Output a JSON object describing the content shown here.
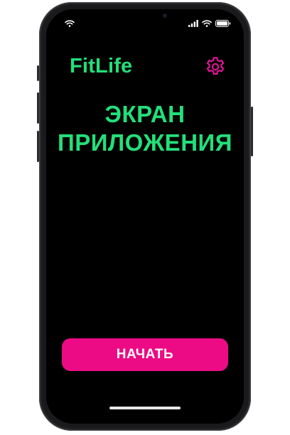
{
  "app": {
    "title": "FitLife",
    "heading_line1": "ЭКРАН",
    "heading_line2": "ПРИЛОЖЕНИЯ"
  },
  "actions": {
    "start_label": "НАЧАТЬ"
  },
  "icons": {
    "settings": "gear-icon",
    "wifi_left": "wifi-icon",
    "cellular": "cellular-signal-icon",
    "wifi_right": "wifi-icon",
    "battery": "battery-icon"
  },
  "colors": {
    "accent_green": "#22e07a",
    "accent_pink": "#ec0b84",
    "background": "#000000",
    "button_text": "#ffffff"
  }
}
